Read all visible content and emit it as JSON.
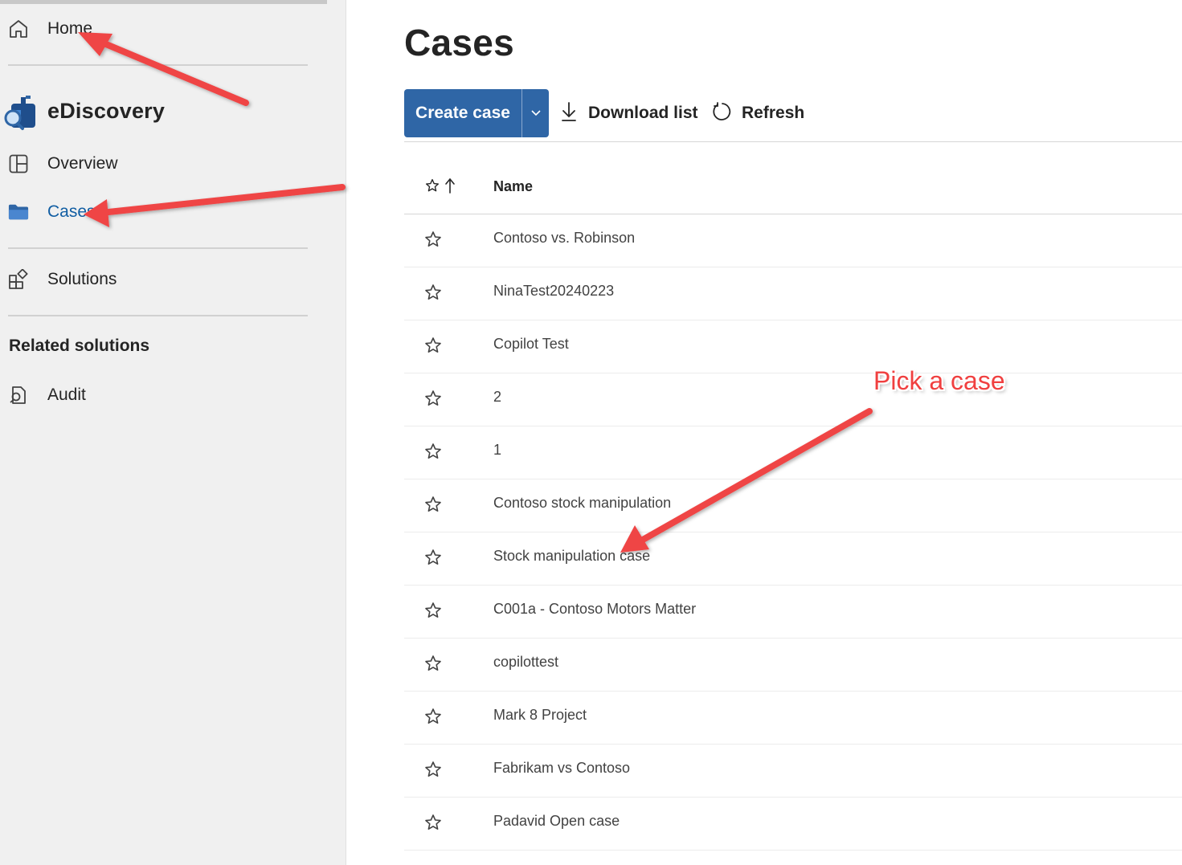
{
  "sidebar": {
    "home_label": "Home",
    "brand_title": "eDiscovery",
    "overview_label": "Overview",
    "cases_label": "Cases",
    "solutions_label": "Solutions",
    "related_heading": "Related solutions",
    "audit_label": "Audit",
    "active_item": "Cases"
  },
  "main": {
    "page_title": "Cases",
    "toolbar": {
      "create_label": "Create case",
      "download_label": "Download list",
      "refresh_label": "Refresh"
    },
    "table": {
      "name_header": "Name",
      "rows": [
        {
          "name": "Contoso vs. Robinson"
        },
        {
          "name": "NinaTest20240223"
        },
        {
          "name": "Copilot Test"
        },
        {
          "name": "2"
        },
        {
          "name": "1"
        },
        {
          "name": "Contoso stock manipulation"
        },
        {
          "name": "Stock manipulation case"
        },
        {
          "name": "C001a - Contoso Motors Matter"
        },
        {
          "name": "copilottest"
        },
        {
          "name": "Mark 8 Project"
        },
        {
          "name": "Fabrikam vs Contoso"
        },
        {
          "name": "Padavid Open case"
        }
      ]
    }
  },
  "annotation": {
    "callout_text": "Pick a case",
    "color": "#f04040"
  },
  "colors": {
    "primary": "#2f66a6",
    "active_nav": "#115ea3",
    "sidebar_bg": "#f0f0f0"
  },
  "icons": {
    "home": "home-icon",
    "brand": "ediscovery-logo-icon",
    "overview": "overview-grid-icon",
    "cases": "folder-icon",
    "solutions": "solutions-icon",
    "audit": "audit-icon",
    "download": "download-icon",
    "refresh": "refresh-icon",
    "star": "star-icon",
    "sort": "sort-ascending-icon",
    "dropdown": "chevron-down-icon"
  }
}
